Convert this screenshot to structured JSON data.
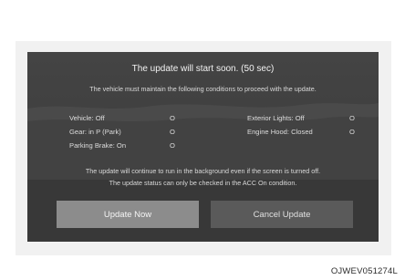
{
  "dialog": {
    "title": "The update will start soon. (50 sec)",
    "subtitle": "The vehicle must maintain the following conditions to proceed with the update.",
    "conditions_left": [
      {
        "label": "Vehicle: Off",
        "status": "O"
      },
      {
        "label": "Gear: in P (Park)",
        "status": "O"
      },
      {
        "label": "Parking Brake: On",
        "status": "O"
      }
    ],
    "conditions_right": [
      {
        "label": "Exterior Lights: Off",
        "status": "O"
      },
      {
        "label": "Engine Hood: Closed",
        "status": "O"
      }
    ],
    "note_line1": "The update will continue to run in the background even if the screen is turned off.",
    "note_line2": "The update status can only be checked in the ACC On condition.",
    "update_now_label": "Update Now",
    "cancel_label": "Cancel Update"
  },
  "caption": "OJWEV051274L",
  "colors": {
    "screen_bg": "#3b3b3b",
    "primary_button": "#8c8c8c",
    "secondary_button": "#5a5a5a"
  }
}
